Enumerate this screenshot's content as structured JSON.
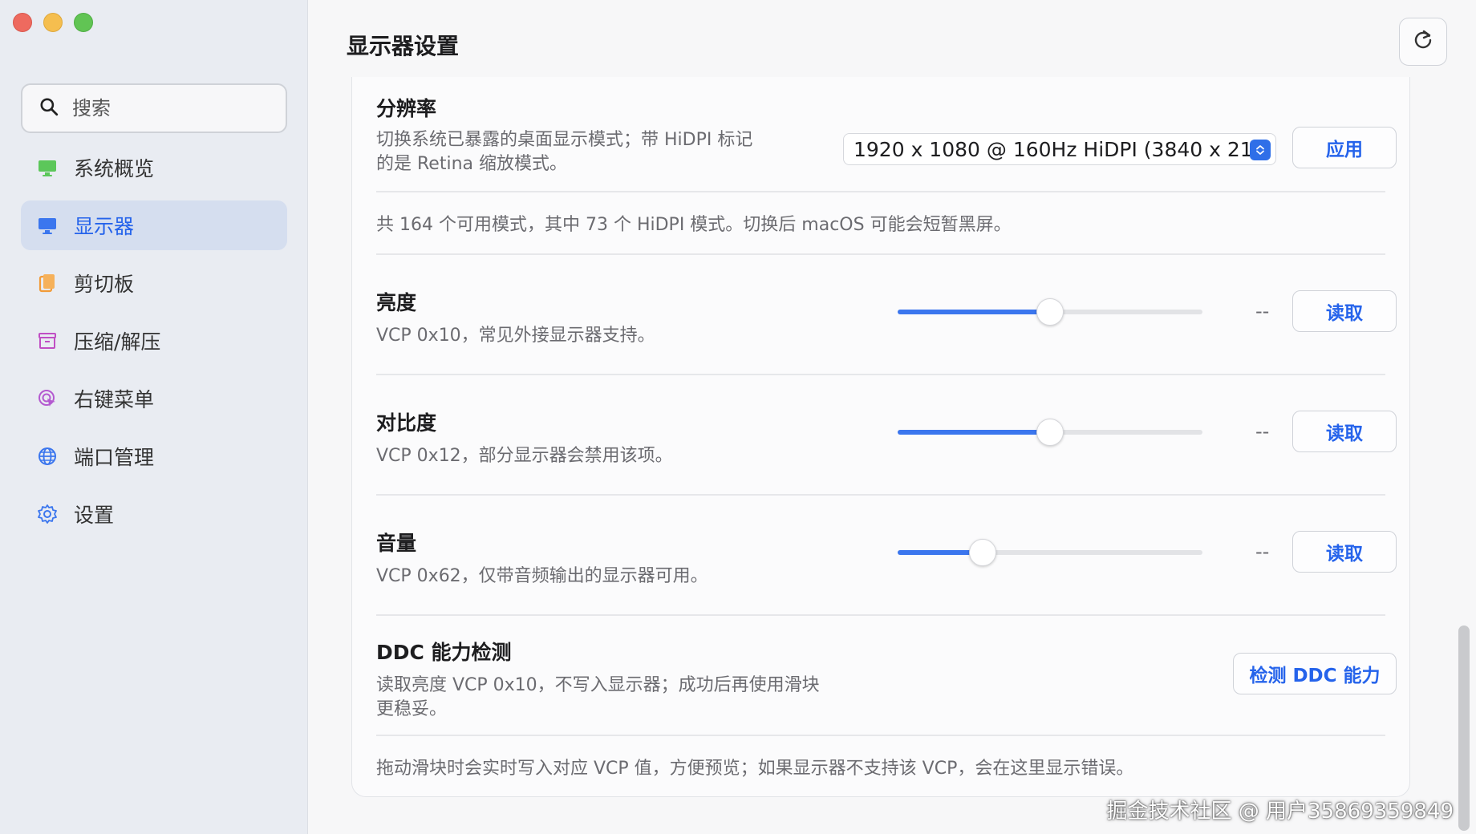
{
  "window": {
    "title": "显示器设置"
  },
  "sidebar": {
    "search_placeholder": "搜索",
    "items": [
      {
        "label": "系统概览",
        "icon": "monitor-green-icon",
        "active": false
      },
      {
        "label": "显示器",
        "icon": "display-icon",
        "active": true
      },
      {
        "label": "剪切板",
        "icon": "clipboard-icon",
        "active": false
      },
      {
        "label": "压缩/解压",
        "icon": "archive-box-icon",
        "active": false
      },
      {
        "label": "右键菜单",
        "icon": "context-menu-icon",
        "active": false
      },
      {
        "label": "端口管理",
        "icon": "globe-icon",
        "active": false
      },
      {
        "label": "设置",
        "icon": "gear-icon",
        "active": false
      }
    ]
  },
  "resolution": {
    "title": "分辨率",
    "desc_line1": "切换系统已暴露的桌面显示模式；带 HiDPI 标记",
    "desc_line2": "的是 Retina 缩放模式。",
    "selected": "1920 x 1080 @ 160Hz HiDPI (3840 x 21...",
    "apply_label": "应用",
    "note": "共 164 个可用模式，其中 73 个 HiDPI 模式。切换后 macOS 可能会短暂黑屏。"
  },
  "controls": [
    {
      "title": "亮度",
      "desc": "VCP 0x10，常见外接显示器支持。",
      "value_text": "--",
      "level": 0.5,
      "button": "读取"
    },
    {
      "title": "对比度",
      "desc": "VCP 0x12，部分显示器会禁用该项。",
      "value_text": "--",
      "level": 0.5,
      "button": "读取"
    },
    {
      "title": "音量",
      "desc": "VCP 0x62，仅带音频输出的显示器可用。",
      "value_text": "--",
      "level": 0.28,
      "button": "读取"
    }
  ],
  "ddc": {
    "title": "DDC 能力检测",
    "desc_line1": "读取亮度 VCP 0x10，不写入显示器；成功后再使用滑块",
    "desc_line2": "更稳妥。",
    "button": "检测 DDC 能力"
  },
  "footer_note": "拖动滑块时会实时写入对应 VCP 值，方便预览；如果显示器不支持该 VCP，会在这里显示错误。",
  "watermark": "掘金技术社区 @ 用户35869359849",
  "colors": {
    "accent": "#2563eb",
    "slider_fill": "#3b76ee",
    "sidebar_bg": "#e9ecf2",
    "active_bg": "#d5deef"
  }
}
